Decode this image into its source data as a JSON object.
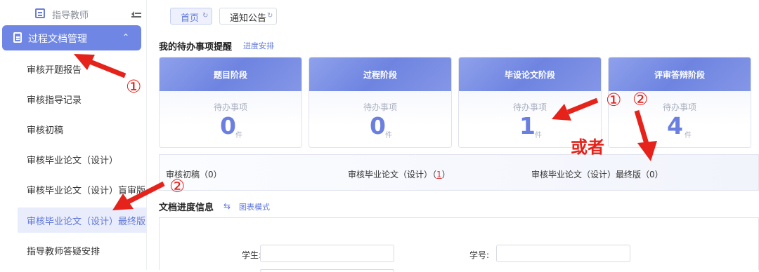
{
  "sidebar": {
    "role": "指导教师",
    "menu_parent": "过程文档管理",
    "items": [
      {
        "label": "审核开题报告"
      },
      {
        "label": "审核指导记录"
      },
      {
        "label": "审核初稿"
      },
      {
        "label": "审核毕业论文（设计）"
      },
      {
        "label": "审核毕业论文（设计）盲审版"
      },
      {
        "label": "审核毕业论文（设计）最终版"
      },
      {
        "label": "指导教师答疑安排"
      }
    ]
  },
  "tabs": [
    {
      "label": "首页"
    },
    {
      "label": "通知公告"
    }
  ],
  "todo": {
    "title": "我的待办事项提醒",
    "link": "进度安排",
    "cards": [
      {
        "title": "题目阶段",
        "sub": "待办事项",
        "count": "0",
        "unit": "件"
      },
      {
        "title": "过程阶段",
        "sub": "待办事项",
        "count": "0",
        "unit": "件"
      },
      {
        "title": "毕设论文阶段",
        "sub": "待办事项",
        "count": "1",
        "unit": "件"
      },
      {
        "title": "评审答辩阶段",
        "sub": "待办事项",
        "count": "4",
        "unit": "件"
      }
    ],
    "summary": [
      {
        "label": "审核初稿",
        "open": "（",
        "count": "0",
        "close": "）"
      },
      {
        "label": "审核毕业论文（设计）",
        "open": "（",
        "count": "1",
        "close": "）"
      },
      {
        "label": "审核毕业论文（设计）最终版",
        "open": "（",
        "count": "0",
        "close": "）"
      }
    ]
  },
  "progress": {
    "title": "文档进度信息",
    "link": "图表模式",
    "fields": [
      {
        "label": "学生:",
        "value": ""
      },
      {
        "label": "学号:",
        "value": ""
      }
    ]
  },
  "annotations": {
    "c1": "①",
    "c2": "②",
    "or": "或者"
  },
  "colors": {
    "accent": "#6f86e4",
    "annotation": "#e5231b"
  }
}
